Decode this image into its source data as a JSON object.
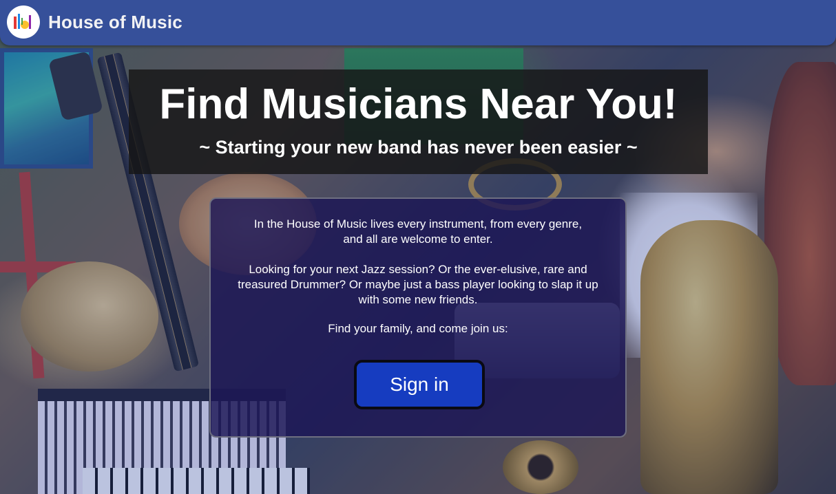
{
  "header": {
    "brand_name": "House of Music",
    "logo_icon": "music-instruments-logo-icon"
  },
  "hero": {
    "title": "Find Musicians Near You!",
    "subtitle": "~ Starting your new band has never been easier ~"
  },
  "panel": {
    "paragraph_1_line_1": "In the House of Music lives every instrument, from every genre,",
    "paragraph_1_line_2": "and all are welcome to enter.",
    "paragraph_2": "Looking for your next Jazz session? Or the ever-elusive, rare and treasured Drummer? Or maybe just a bass player looking to slap it up with some new friends.",
    "paragraph_3": "Find your family, and come join us:",
    "signin_label": "Sign in"
  },
  "colors": {
    "header_bg": "#36509a",
    "button_bg": "#163cc0",
    "panel_bg": "#1c1656"
  }
}
